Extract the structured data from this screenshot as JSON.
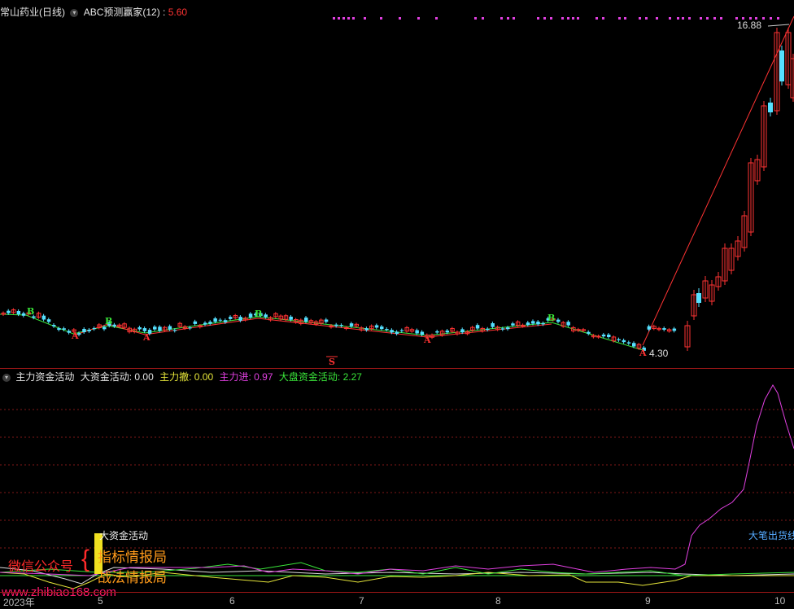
{
  "upper_header": {
    "stock_name": "常山药业(日线)",
    "indicator": "ABC预测赢家(12)",
    "sep": ":",
    "value": "5.60"
  },
  "price_labels": {
    "high": "16.88",
    "low": "4.30"
  },
  "signal_marks": {
    "buy": "B",
    "turn": "A",
    "sell": "S"
  },
  "lower_header": {
    "indicator": "主力资金活动",
    "items": [
      {
        "label": "大资金活动:",
        "value": "0.00",
        "color": "#e6e6e6"
      },
      {
        "label": "主力撤:",
        "value": "0.00",
        "color": "#e6e63a"
      },
      {
        "label": "主力进:",
        "value": "0.97",
        "color": "#e040e0"
      },
      {
        "label": "大盘资金活动:",
        "value": "2.27",
        "color": "#3ae63a"
      }
    ]
  },
  "annotations": {
    "big_fund": "大资金活动",
    "big_sell": "大笔出货",
    "big_sell_tail": "线"
  },
  "watermark": {
    "wechat": "微信公众号",
    "brace": "{",
    "line1": "指标情报局",
    "line2": "战法情报局",
    "site": "www.zhibiao168.com"
  },
  "x_axis": {
    "labels": [
      "2023年",
      "5",
      "6",
      "7",
      "8",
      "9",
      "10"
    ]
  },
  "colors": {
    "up": "#ff3333",
    "down": "#55e0ff",
    "magenta": "#e040e0",
    "green": "#3ae63a",
    "yellow": "#e6e63a",
    "grid": "#801818"
  }
}
